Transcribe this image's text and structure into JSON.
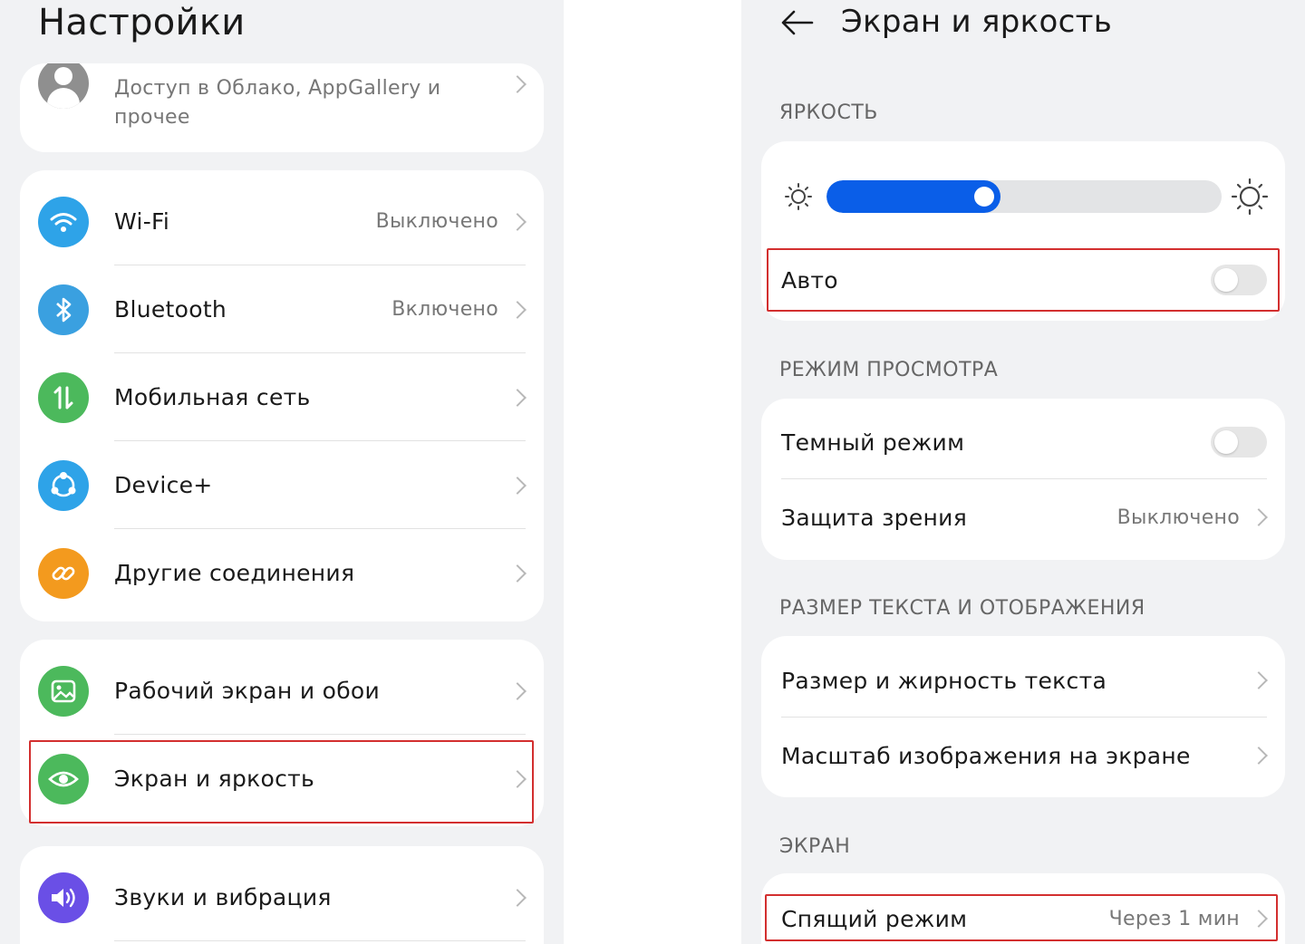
{
  "left": {
    "title": "Настройки",
    "account": {
      "subtitle": "Доступ в Облако, AppGallery и прочее"
    },
    "group1": [
      {
        "label": "Wi-Fi",
        "value": "Выключено",
        "icon": "wifi-icon",
        "color": "#2ea3e8"
      },
      {
        "label": "Bluetooth",
        "value": "Включено",
        "icon": "bluetooth-icon",
        "color": "#3aa0e0"
      },
      {
        "label": "Мобильная сеть",
        "value": "",
        "icon": "mobile-data-icon",
        "color": "#4cb95c"
      },
      {
        "label": "Device+",
        "value": "",
        "icon": "device-plus-icon",
        "color": "#2ea3e8"
      },
      {
        "label": "Другие соединения",
        "value": "",
        "icon": "link-icon",
        "color": "#f39a1e"
      }
    ],
    "group2": [
      {
        "label": "Рабочий экран и обои",
        "icon": "wallpaper-icon",
        "color": "#4cb95c"
      },
      {
        "label": "Экран и яркость",
        "icon": "eye-icon",
        "color": "#4cb95c"
      }
    ],
    "group3": [
      {
        "label": "Звуки и вибрация",
        "icon": "speaker-icon",
        "color": "#6a4fe6"
      }
    ]
  },
  "right": {
    "title": "Экран и яркость",
    "brightness": {
      "section": "ЯРКОСТЬ",
      "level": 0.44,
      "accent": "#0a5ee8",
      "auto_label": "Авто",
      "auto_on": false
    },
    "view_mode": {
      "section": "РЕЖИМ ПРОСМОТРА",
      "dark_label": "Темный режим",
      "dark_on": false,
      "eye_label": "Защита зрения",
      "eye_value": "Выключено"
    },
    "text_size": {
      "section": "РАЗМЕР ТЕКСТА И ОТОБРАЖЕНИЯ",
      "font_label": "Размер и жирность текста",
      "scale_label": "Масштаб изображения на экране"
    },
    "screen": {
      "section": "ЭКРАН",
      "sleep_label": "Спящий режим",
      "sleep_value": "Через 1 мин"
    }
  },
  "highlight_color": "#d32f2f"
}
